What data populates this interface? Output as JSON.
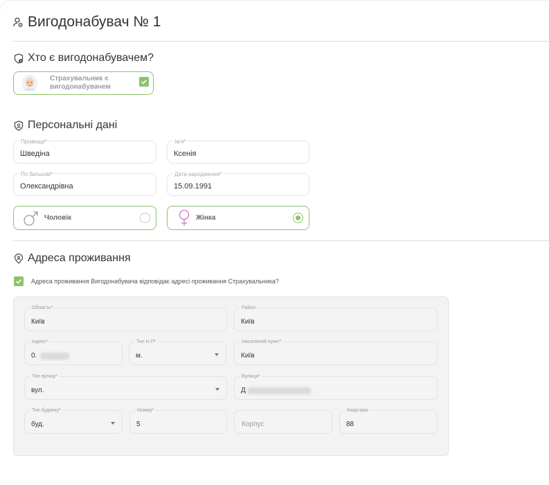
{
  "header": {
    "title": "Вигодонабувач № 1"
  },
  "who": {
    "title": "Хто є вигодонабувачем?",
    "card_label": "Страхувальник є вигодонабувачем",
    "card_checked": true
  },
  "personal": {
    "title": "Персональні дані",
    "surname_label": "Прізвище*",
    "surname_value": "Шведіна",
    "name_label": "Ім'я*",
    "name_value": "Ксенія",
    "patronymic_label": "По батькові*",
    "patronymic_value": "Олександрівна",
    "birthdate_label": "Дата народження*",
    "birthdate_value": "15.09.1991",
    "gender_male": "Чоловік",
    "gender_female": "Жінка",
    "gender_selected": "female"
  },
  "address": {
    "title": "Адреса проживання",
    "same_address_label": "Адреса проживання Вигодонабувача відповідає адресі проживання Страхувальника?",
    "same_address_checked": true,
    "region_label": "Область*",
    "region_value": "Київ",
    "district_label": "Район",
    "district_value": "Київ",
    "index_label": "Індекс*",
    "index_value": "0.",
    "settlement_type_label": "Тип Н.П*",
    "settlement_type_value": "м.",
    "settlement_label": "Населений пункт*",
    "settlement_value": "Київ",
    "street_type_label": "Тип вулиці*",
    "street_type_value": "вул.",
    "street_label": "Вулиця*",
    "street_value": "Д",
    "building_type_label": "Тип будинку*",
    "building_type_value": "буд.",
    "number_label": "Номер*",
    "number_value": "5",
    "block_placeholder": "Корпус",
    "apartment_label": "Квартира",
    "apartment_value": "88"
  },
  "colors": {
    "accent_green": "#8cc26b",
    "female_pink": "#c77ac0",
    "male_gray": "#888888"
  }
}
